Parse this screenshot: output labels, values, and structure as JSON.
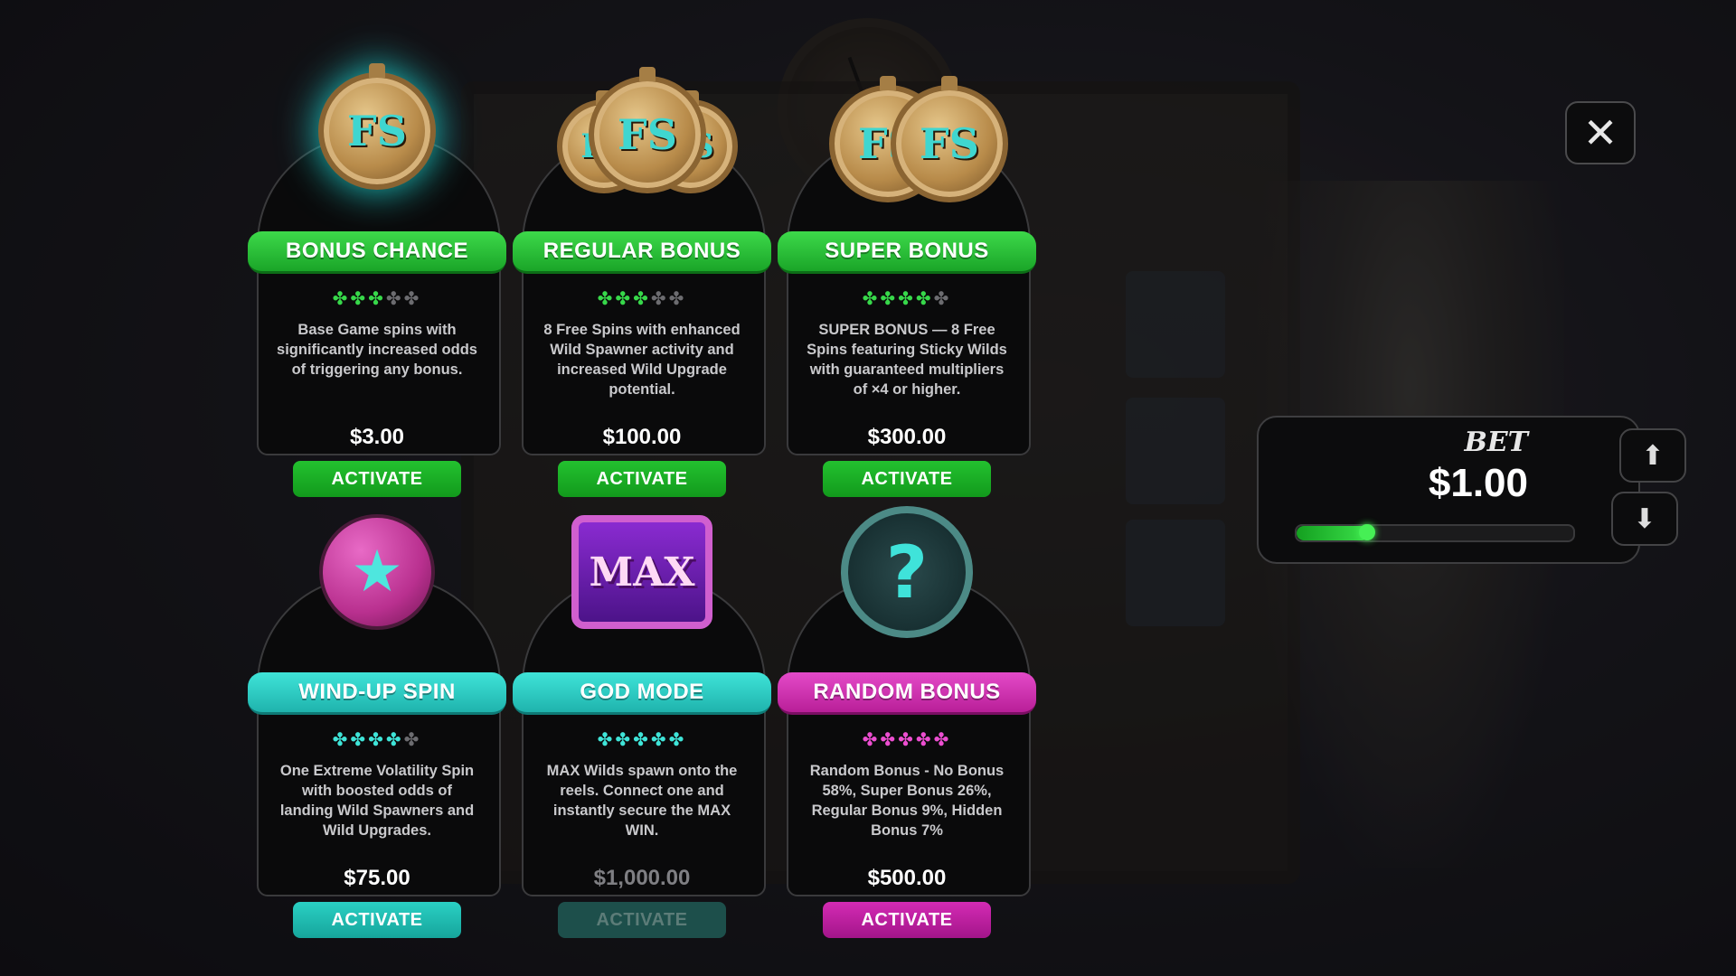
{
  "close_label": "✕",
  "bet": {
    "label": "BET",
    "value": "$1.00",
    "level": 0.26,
    "up_icon": "⬆",
    "down_icon": "⬇"
  },
  "colors": {
    "green": "#23c12f",
    "teal": "#2ad0c4",
    "magenta": "#d42bb4"
  },
  "cards": [
    {
      "icon": "fs-coin-glow-icon",
      "title": "BONUS CHANCE",
      "stars_on": 3,
      "stars_total": 5,
      "description": "Base Game spins with significantly increased odds of triggering any bonus.",
      "price": "$3.00",
      "button": "ACTIVATE",
      "theme": "green",
      "enabled": true
    },
    {
      "icon": "fs-coins-stack-icon",
      "title": "REGULAR BONUS",
      "stars_on": 3,
      "stars_total": 5,
      "description": "8 Free Spins with enhanced Wild Spawner activity and increased Wild Upgrade potential.",
      "price": "$100.00",
      "button": "ACTIVATE",
      "theme": "green",
      "enabled": true
    },
    {
      "icon": "fs-coins-pair-icon",
      "title": "SUPER BONUS",
      "stars_on": 4,
      "stars_total": 5,
      "description": "SUPER BONUS — 8 Free Spins featuring Sticky Wilds with guaranteed multipliers of ×4 or higher.",
      "price": "$300.00",
      "button": "ACTIVATE",
      "theme": "green",
      "enabled": true
    },
    {
      "icon": "wind-up-bomb-icon",
      "title": "WIND-UP SPIN",
      "stars_on": 4,
      "stars_total": 5,
      "description": "One Extreme Volatility Spin with boosted odds of landing Wild Spawners and Wild Upgrades.",
      "price": "$75.00",
      "button": "ACTIVATE",
      "theme": "teal",
      "enabled": true
    },
    {
      "icon": "max-box-icon",
      "title": "GOD MODE",
      "stars_on": 5,
      "stars_total": 5,
      "description": "MAX Wilds spawn onto the reels. Connect one and instantly secure the MAX WIN.",
      "price": "$1,000.00",
      "button": "ACTIVATE",
      "theme": "teal",
      "enabled": false
    },
    {
      "icon": "question-clock-icon",
      "title": "RANDOM BONUS",
      "stars_on": 5,
      "stars_total": 5,
      "description": "Random Bonus - No Bonus 58%, Super Bonus 26%, Regular Bonus 9%, Hidden Bonus 7%",
      "price": "$500.00",
      "button": "ACTIVATE",
      "theme": "magenta",
      "enabled": true
    }
  ],
  "icon_text": {
    "fs": "FS",
    "max": "MAX",
    "question": "?",
    "star": "★",
    "clover": "✤"
  }
}
